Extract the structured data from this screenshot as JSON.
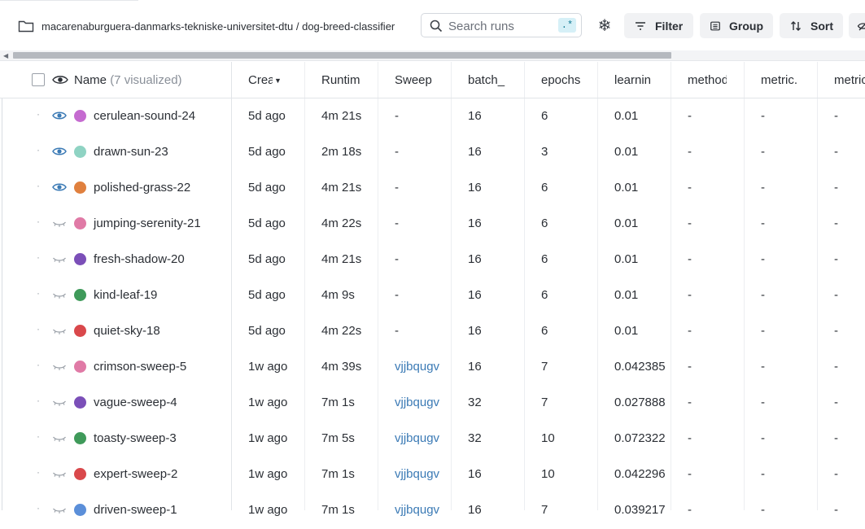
{
  "project": {
    "path": "macarenaburguera-danmarks-tekniske-universitet-dtu / dog-breed-classifier"
  },
  "search": {
    "placeholder": "Search runs",
    "regex_label": ".*"
  },
  "toolbar": {
    "filter_label": "Filter",
    "group_label": "Group",
    "sort_label": "Sort"
  },
  "columns": {
    "name": "Name",
    "visualized": "(7 visualized)",
    "created": "Created",
    "runtime": "Runtime",
    "sweep": "Sweep",
    "batch": "batch_",
    "epochs": "epochs",
    "lr": "learnin",
    "method": "method",
    "metric1": "metric.",
    "metric2": "metric"
  },
  "rows": [
    {
      "name": "cerulean-sound-24",
      "color": "#c56bd0",
      "visible": true,
      "created": "5d ago",
      "runtime": "4m 21s",
      "sweep": "-",
      "batch": "16",
      "epochs": "6",
      "lr": "0.01",
      "method": "-",
      "metric1": "-",
      "metric2": "-"
    },
    {
      "name": "drawn-sun-23",
      "color": "#8fd3c3",
      "visible": true,
      "created": "5d ago",
      "runtime": "2m 18s",
      "sweep": "-",
      "batch": "16",
      "epochs": "3",
      "lr": "0.01",
      "method": "-",
      "metric1": "-",
      "metric2": "-"
    },
    {
      "name": "polished-grass-22",
      "color": "#e0803e",
      "visible": true,
      "created": "5d ago",
      "runtime": "4m 21s",
      "sweep": "-",
      "batch": "16",
      "epochs": "6",
      "lr": "0.01",
      "method": "-",
      "metric1": "-",
      "metric2": "-"
    },
    {
      "name": "jumping-serenity-21",
      "color": "#e07aa6",
      "visible": false,
      "created": "5d ago",
      "runtime": "4m 22s",
      "sweep": "-",
      "batch": "16",
      "epochs": "6",
      "lr": "0.01",
      "method": "-",
      "metric1": "-",
      "metric2": "-"
    },
    {
      "name": "fresh-shadow-20",
      "color": "#7b4fb8",
      "visible": false,
      "created": "5d ago",
      "runtime": "4m 21s",
      "sweep": "-",
      "batch": "16",
      "epochs": "6",
      "lr": "0.01",
      "method": "-",
      "metric1": "-",
      "metric2": "-"
    },
    {
      "name": "kind-leaf-19",
      "color": "#3f9a5a",
      "visible": false,
      "created": "5d ago",
      "runtime": "4m 9s",
      "sweep": "-",
      "batch": "16",
      "epochs": "6",
      "lr": "0.01",
      "method": "-",
      "metric1": "-",
      "metric2": "-"
    },
    {
      "name": "quiet-sky-18",
      "color": "#d9484b",
      "visible": false,
      "created": "5d ago",
      "runtime": "4m 22s",
      "sweep": "-",
      "batch": "16",
      "epochs": "6",
      "lr": "0.01",
      "method": "-",
      "metric1": "-",
      "metric2": "-"
    },
    {
      "name": "crimson-sweep-5",
      "color": "#e07aa6",
      "visible": false,
      "created": "1w ago",
      "runtime": "4m 39s",
      "sweep": "vjjbqugv",
      "batch": "16",
      "epochs": "7",
      "lr": "0.042385",
      "method": "-",
      "metric1": "-",
      "metric2": "-"
    },
    {
      "name": "vague-sweep-4",
      "color": "#7b4fb8",
      "visible": false,
      "created": "1w ago",
      "runtime": "7m 1s",
      "sweep": "vjjbqugv",
      "batch": "32",
      "epochs": "7",
      "lr": "0.027888",
      "method": "-",
      "metric1": "-",
      "metric2": "-"
    },
    {
      "name": "toasty-sweep-3",
      "color": "#3f9a5a",
      "visible": false,
      "created": "1w ago",
      "runtime": "7m 5s",
      "sweep": "vjjbqugv",
      "batch": "32",
      "epochs": "10",
      "lr": "0.072322",
      "method": "-",
      "metric1": "-",
      "metric2": "-"
    },
    {
      "name": "expert-sweep-2",
      "color": "#d9484b",
      "visible": false,
      "created": "1w ago",
      "runtime": "7m 1s",
      "sweep": "vjjbqugv",
      "batch": "16",
      "epochs": "10",
      "lr": "0.042296",
      "method": "-",
      "metric1": "-",
      "metric2": "-"
    },
    {
      "name": "driven-sweep-1",
      "color": "#5b8fd9",
      "visible": false,
      "created": "1w ago",
      "runtime": "7m 1s",
      "sweep": "vjjbqugv",
      "batch": "16",
      "epochs": "7",
      "lr": "0.039217",
      "method": "-",
      "metric1": "-",
      "metric2": "-"
    }
  ]
}
